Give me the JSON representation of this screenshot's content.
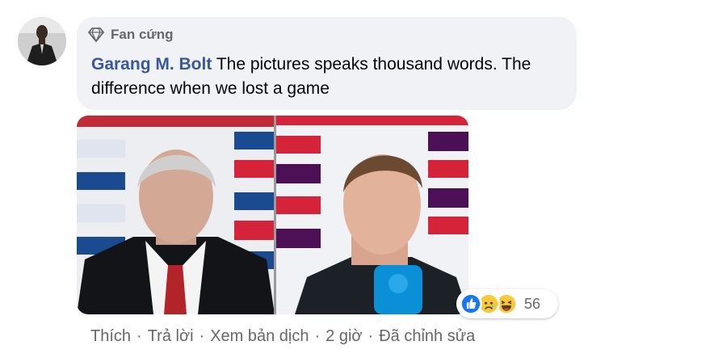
{
  "comment": {
    "badge": "Fan cứng",
    "author": "Garang M. Bolt",
    "text": "The pictures speaks thousand words. The difference when we lost a game"
  },
  "reactions": {
    "icons": [
      "like-icon",
      "sad-icon",
      "haha-icon"
    ],
    "count": "56"
  },
  "actions": {
    "like": "Thích",
    "reply": "Trả lời",
    "translate": "Xem bản dịch",
    "time": "2 giờ",
    "edited": "Đã chỉnh sửa",
    "separator": "·"
  }
}
